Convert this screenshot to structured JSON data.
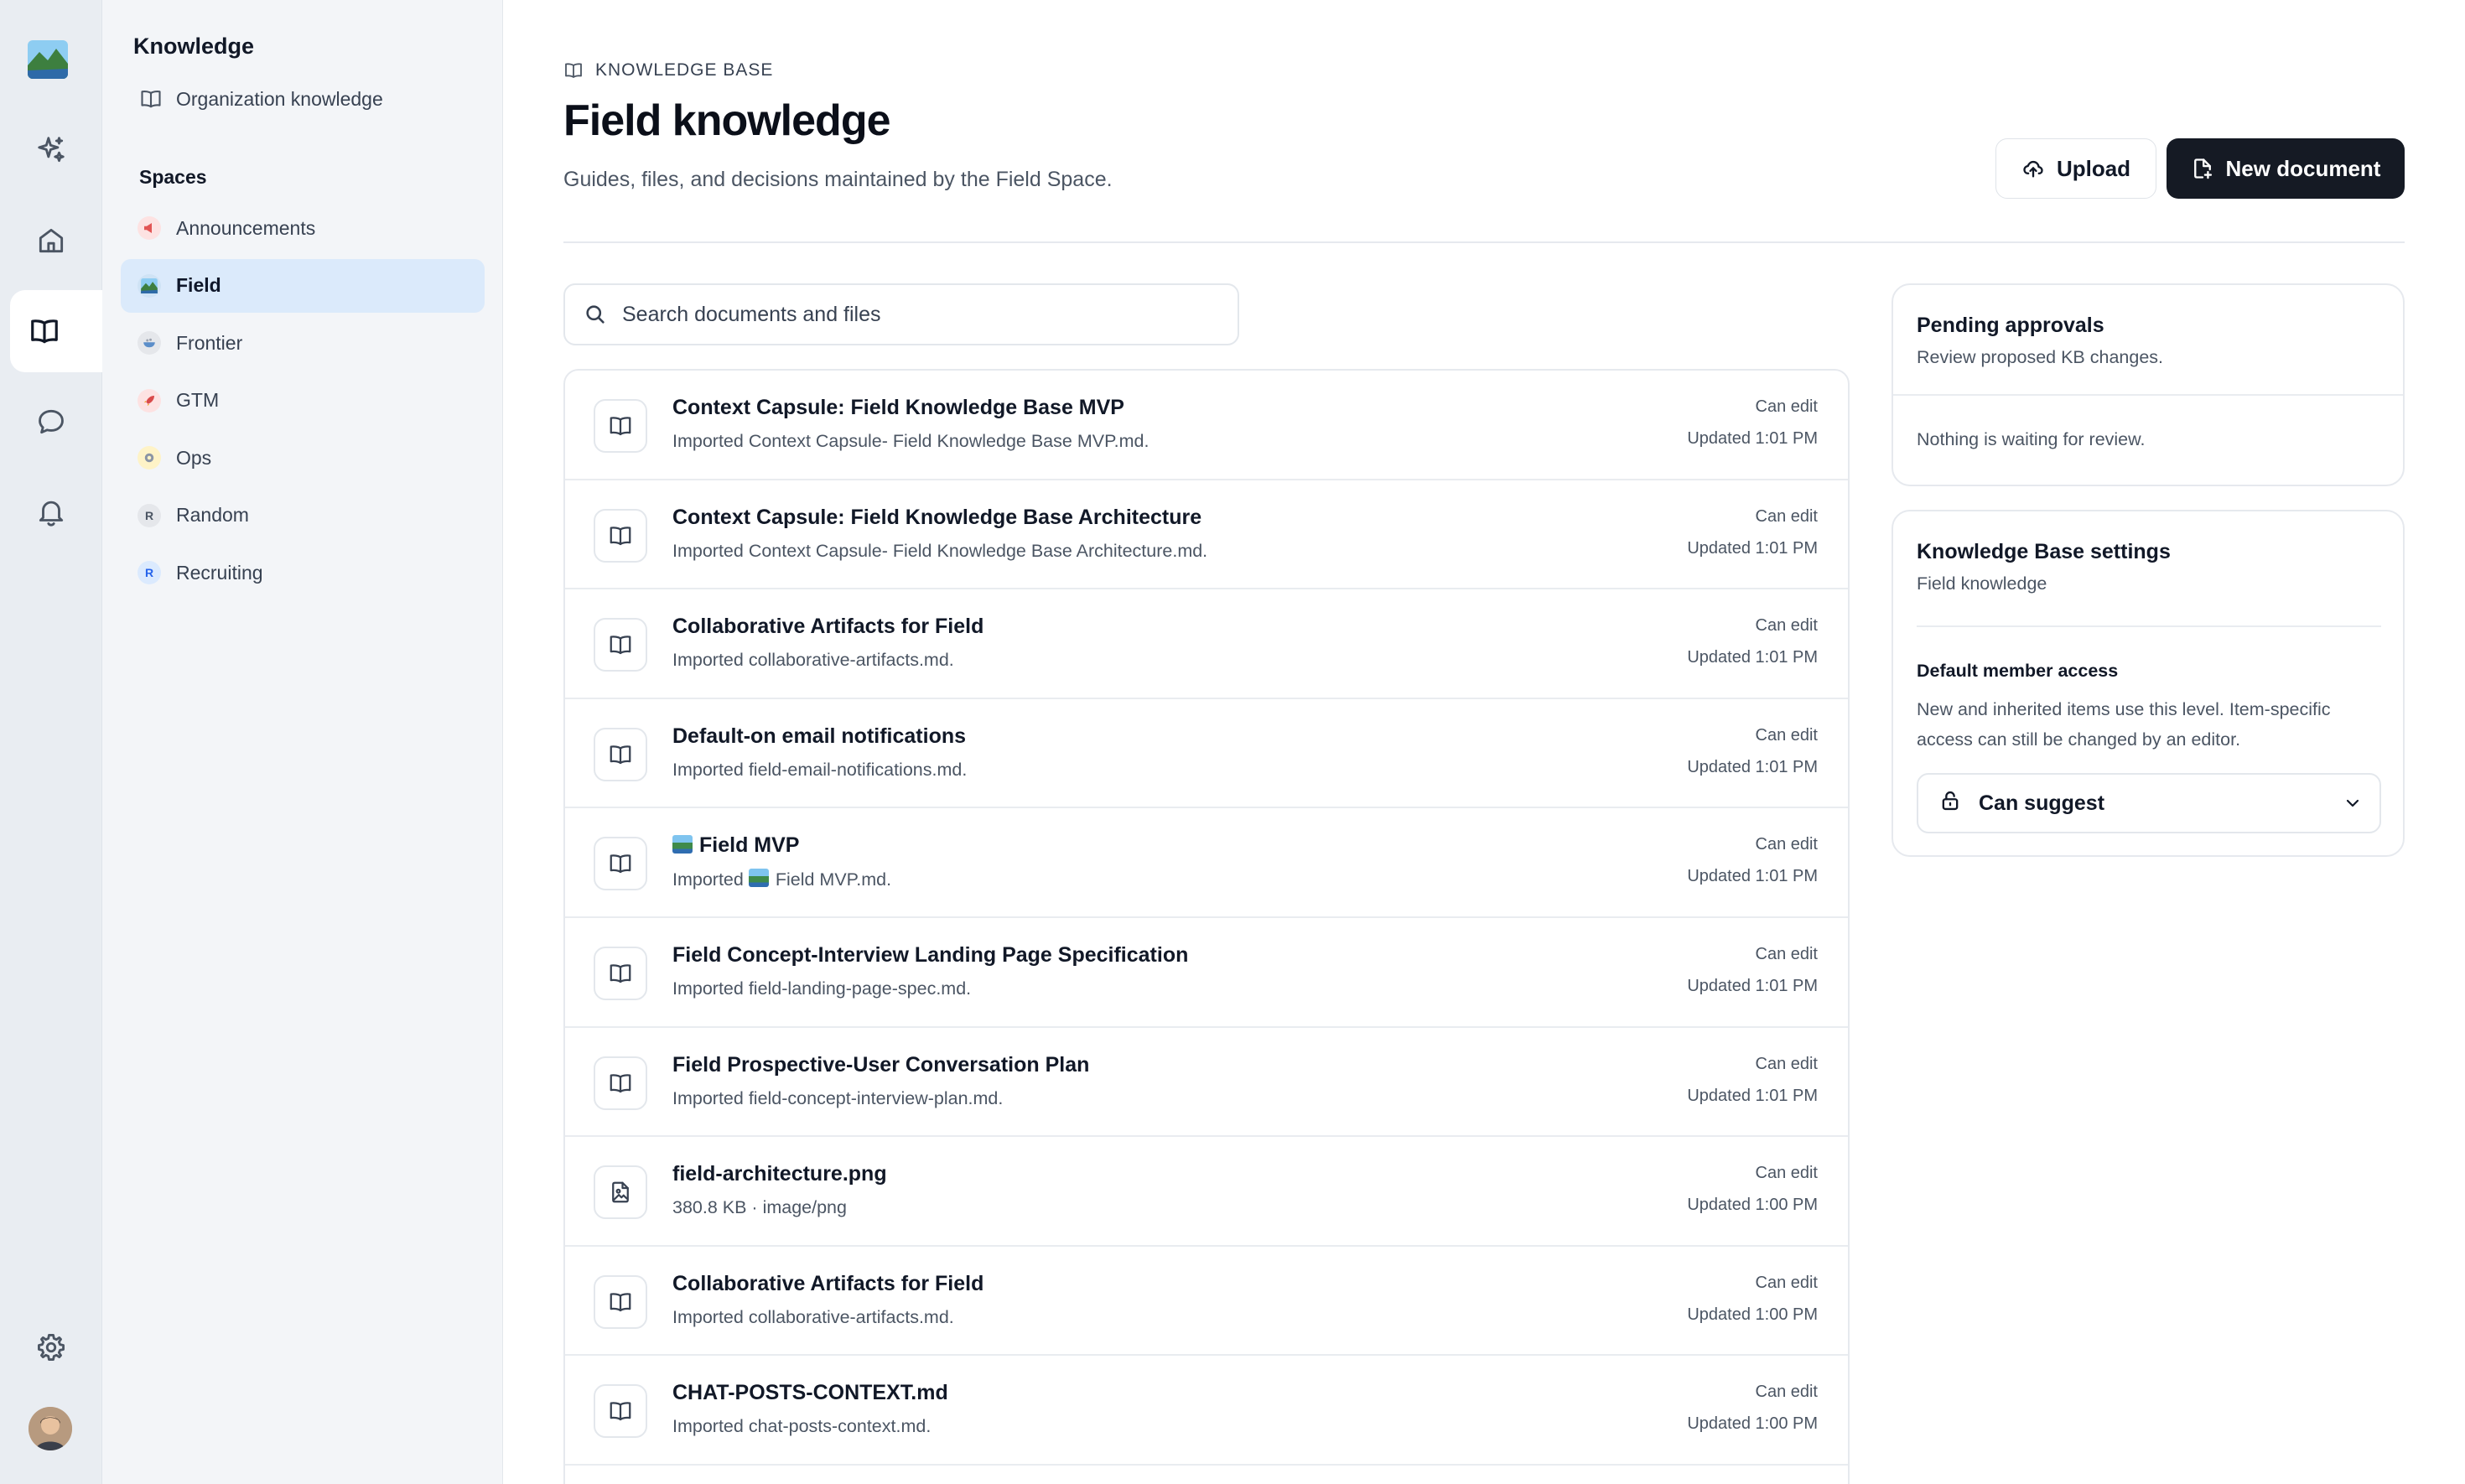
{
  "rail": {
    "items": [
      {
        "name": "sparkles-icon"
      },
      {
        "name": "home-icon"
      },
      {
        "name": "book-icon"
      },
      {
        "name": "chat-icon"
      },
      {
        "name": "bell-icon"
      },
      {
        "name": "gear-icon"
      }
    ],
    "active": "book-icon"
  },
  "sidebar": {
    "title": "Knowledge",
    "org_link": "Organization knowledge",
    "spaces_heading": "Spaces",
    "spaces": [
      {
        "label": "Announcements",
        "icon": "megaphone-icon"
      },
      {
        "label": "Field",
        "icon": "landscape-icon"
      },
      {
        "label": "Frontier",
        "icon": "bowl-icon"
      },
      {
        "label": "GTM",
        "icon": "rocket-icon"
      },
      {
        "label": "Ops",
        "icon": "gear-emoji-icon"
      },
      {
        "label": "Random",
        "icon": "letter-r-icon",
        "letter": "R"
      },
      {
        "label": "Recruiting",
        "icon": "letter-r-icon",
        "letter": "R"
      }
    ],
    "active_space": "Field"
  },
  "header": {
    "eyebrow": "KNOWLEDGE BASE",
    "title": "Field knowledge",
    "subtitle": "Guides, files, and decisions maintained by the Field Space.",
    "upload_label": "Upload",
    "new_document_label": "New document"
  },
  "search": {
    "placeholder": "Search documents and files",
    "value": ""
  },
  "documents": [
    {
      "title": "Context Capsule: Field Knowledge Base MVP",
      "subtitle": "Imported Context Capsule- Field Knowledge Base MVP.md.",
      "permission": "Can edit",
      "updated": "Updated 1:01 PM",
      "icon": "book-icon"
    },
    {
      "title": "Context Capsule: Field Knowledge Base Architecture",
      "subtitle": "Imported Context Capsule- Field Knowledge Base Architecture.md.",
      "permission": "Can edit",
      "updated": "Updated 1:01 PM",
      "icon": "book-icon"
    },
    {
      "title": "Collaborative Artifacts for Field",
      "subtitle": "Imported collaborative-artifacts.md.",
      "permission": "Can edit",
      "updated": "Updated 1:01 PM",
      "icon": "book-icon"
    },
    {
      "title": "Default-on email notifications",
      "subtitle": "Imported field-email-notifications.md.",
      "permission": "Can edit",
      "updated": "Updated 1:01 PM",
      "icon": "book-icon"
    },
    {
      "title": "Field MVP",
      "subtitle_prefix": "Imported",
      "subtitle": "Field MVP.md.",
      "permission": "Can edit",
      "updated": "Updated 1:01 PM",
      "icon": "book-icon",
      "emoji": "landscape-icon"
    },
    {
      "title": "Field Concept-Interview Landing Page Specification",
      "subtitle": "Imported field-landing-page-spec.md.",
      "permission": "Can edit",
      "updated": "Updated 1:01 PM",
      "icon": "book-icon"
    },
    {
      "title": "Field Prospective-User Conversation Plan",
      "subtitle": "Imported field-concept-interview-plan.md.",
      "permission": "Can edit",
      "updated": "Updated 1:01 PM",
      "icon": "book-icon"
    },
    {
      "title": "field-architecture.png",
      "subtitle": "380.8 KB · image/png",
      "permission": "Can edit",
      "updated": "Updated 1:00 PM",
      "icon": "image-file-icon"
    },
    {
      "title": "Collaborative Artifacts for Field",
      "subtitle": "Imported collaborative-artifacts.md.",
      "permission": "Can edit",
      "updated": "Updated 1:00 PM",
      "icon": "book-icon"
    },
    {
      "title": "CHAT-POSTS-CONTEXT.md",
      "subtitle": "Imported chat-posts-context.md.",
      "permission": "Can edit",
      "updated": "Updated 1:00 PM",
      "icon": "book-icon"
    }
  ],
  "pending": {
    "title": "Pending approvals",
    "subtitle": "Review proposed KB changes.",
    "empty": "Nothing is waiting for review."
  },
  "settings": {
    "title": "Knowledge Base settings",
    "subtitle": "Field knowledge",
    "access_label": "Default member access",
    "access_description": "New and inherited items use this level. Item-specific access can still be changed by an editor.",
    "access_value": "Can suggest"
  },
  "colors": {
    "accent_active": "#dbeafb",
    "primary_button": "#151a24",
    "rail_bg": "#e9edf2",
    "sidebar_bg": "#f3f5f8"
  }
}
